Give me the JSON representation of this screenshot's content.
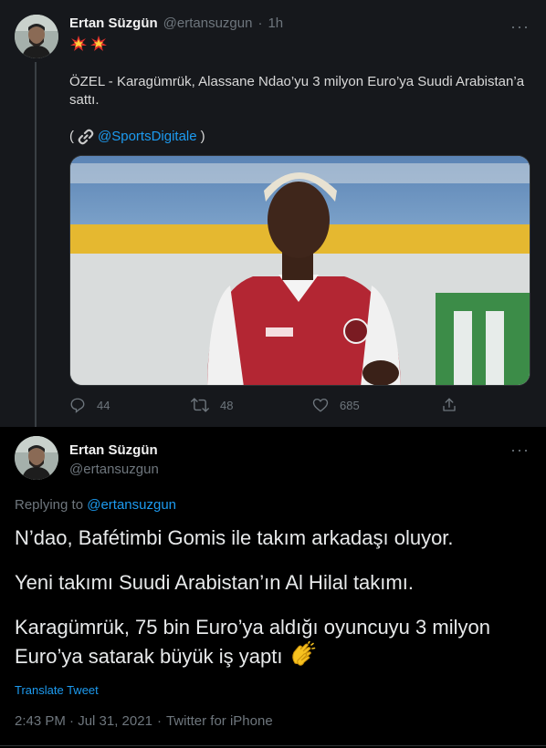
{
  "parent_tweet": {
    "author_name": "Ertan Süzgün",
    "handle": "@ertansuzgun",
    "separator": "·",
    "time": "1h",
    "emoji_icons": [
      "collision-icon",
      "collision-icon"
    ],
    "text": "ÖZEL - Karagümrük, Alassane Ndao’yu 3 milyon Euro’ya Suudi Arabistan’a sattı.",
    "source_open": "(",
    "source_link_icon": "link-icon",
    "source_handle": "@SportsDigitale",
    "source_close": ")",
    "actions": {
      "replies": "44",
      "retweets": "48",
      "likes": "685"
    }
  },
  "main_tweet": {
    "author_name": "Ertan Süzgün",
    "handle": "@ertansuzgun",
    "replying_label": "Replying to",
    "replying_to": "@ertansuzgun",
    "paragraphs": [
      "N’dao, Bafétimbi Gomis ile takım arkadaşı oluyor.",
      "Yeni takımı Suudi Arabistan’ın Al Hilal takımı.",
      "Karagümrük, 75 bin Euro’ya aldığı oyuncuyu 3 milyon Euro’ya satarak büyük iş yaptı"
    ],
    "trailing_emoji_icon": "clapping-hands-icon",
    "translate_label": "Translate Tweet",
    "timestamp": "2:43 PM · Jul 31, 2021",
    "separator": "·",
    "client": "Twitter for iPhone"
  },
  "colors": {
    "background": "#000000",
    "parent_background": "#16181c",
    "link_blue": "#1d9bf0",
    "muted_gray": "#6e767d"
  }
}
